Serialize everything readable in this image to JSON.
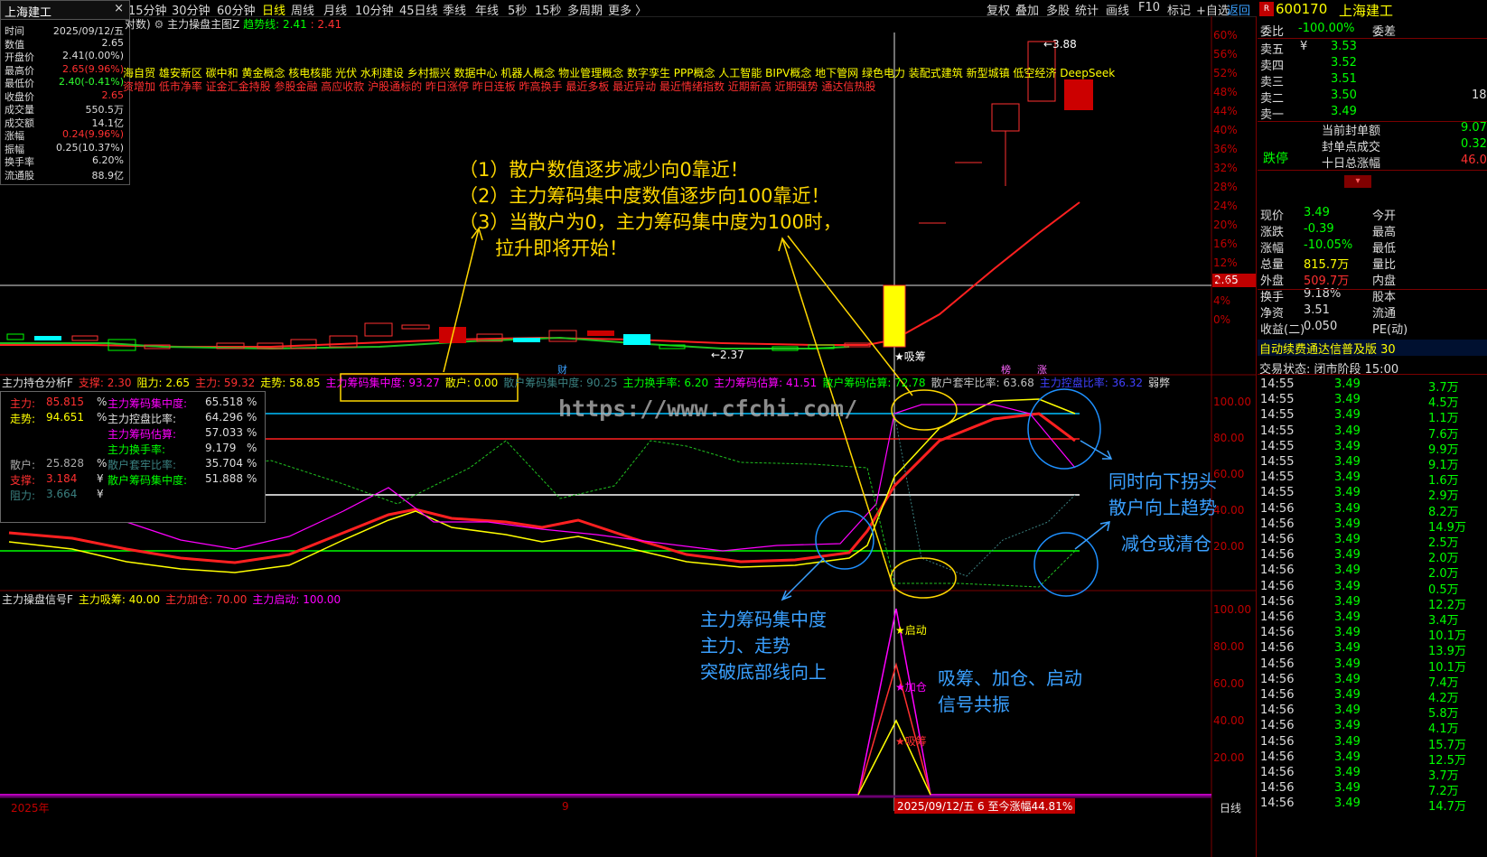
{
  "toolbar": {
    "tabs": [
      "15分钟",
      "30分钟",
      "60分钟",
      "日线",
      "周线",
      "月线",
      "10分钟",
      "45日线",
      "季线",
      "年线",
      "5秒",
      "15秒",
      "多周期",
      "更多 〉"
    ],
    "active_tab": "日线",
    "right_tools": [
      "复权",
      "叠加",
      "多股",
      "统计",
      "画线",
      "F10",
      "标记",
      "+自选",
      "返回"
    ]
  },
  "window": {
    "title": "上海建工",
    "close": "×"
  },
  "info_box": [
    {
      "k": "时间",
      "v": "2025/09/12/五",
      "c": "#ddd"
    },
    {
      "k": "数值",
      "v": "2.65",
      "c": "#ddd"
    },
    {
      "k": "开盘价",
      "v": "2.41(0.00%)",
      "c": "#ddd"
    },
    {
      "k": "最高价",
      "v": "2.65(9.96%)",
      "c": "#ff3030"
    },
    {
      "k": "最低价",
      "v": "2.40(-0.41%)",
      "c": "#30ff30"
    },
    {
      "k": "收盘价",
      "v": "2.65",
      "c": "#ff3030"
    },
    {
      "k": "成交量",
      "v": "550.5万",
      "c": "#ddd"
    },
    {
      "k": "成交额",
      "v": "14.1亿",
      "c": "#ddd"
    },
    {
      "k": "涨幅",
      "v": "0.24(9.96%)",
      "c": "#ff3030"
    },
    {
      "k": "振幅",
      "v": "0.25(10.37%)",
      "c": "#ddd"
    },
    {
      "k": "换手率",
      "v": "6.20%",
      "c": "#ddd"
    },
    {
      "k": "流通股",
      "v": "88.9亿",
      "c": "#ddd"
    }
  ],
  "main_chart": {
    "header_prefix": "对数)",
    "indicator_name": "主力操盘主图Z",
    "trend_label": "趋势线: 2.41",
    "trend_value": ": 2.41",
    "concepts_row1": "海自贸  雄安新区  碳中和  黄金概念  核电核能  光伏  水利建设  乡村振兴  数据中心  机器人概念  物业管理概念  数字孪生  PPP概念  人工智能  BIPV概念  地下管网  绿色电力  装配式建筑  新型城镇  低空经济  DeepSeek",
    "concepts_row2": "资增加  低市净率  证金汇金持股  参股金融  高应收款  沪股通标的  昨日涨停  昨日连板  昨高换手  最近多板  最近异动  最近情绪指数  近期新高  近期强势  通达信热股",
    "price_label": "2.65",
    "high_marker": "←3.88",
    "low_marker": "←2.37",
    "xishou_label": "★吸筹",
    "cai_label": "财",
    "bang_label": "榜",
    "zhang_label": "涨",
    "yaxis": [
      "60%",
      "56%",
      "52%",
      "48%",
      "44%",
      "40%",
      "36%",
      "32%",
      "28%",
      "24%",
      "20%",
      "16%",
      "12%",
      "8%",
      "4%",
      "0%"
    ]
  },
  "annotations": {
    "main_text": [
      "（1）散户数值逐步减少向0靠近！",
      "（2）主力筹码集中度数值逐步向100靠近！",
      "（3）当散户为0，主力筹码集中度为100时，",
      "      拉升即将开始！"
    ],
    "break_text": [
      "主力筹码集中度",
      "主力、走势",
      "突破底部线向上"
    ],
    "turn_text": [
      "同时向下拐头",
      "散户向上趋势"
    ],
    "reduce_text": "减仓或清仓",
    "signal_text": [
      "吸筹、加仓、启动",
      "信号共振"
    ],
    "watermark": "https://www.cfchi.com/"
  },
  "sub1": {
    "header": [
      {
        "t": "主力持仓分析F",
        "c": "#e0e0e0"
      },
      {
        "t": "支撑: 2.30",
        "c": "#ff3030"
      },
      {
        "t": "阻力: 2.65",
        "c": "#ffff00"
      },
      {
        "t": "主力: 59.32",
        "c": "#ff3030"
      },
      {
        "t": "走势: 58.85",
        "c": "#ffff00"
      },
      {
        "t": "主力筹码集中度: 93.27",
        "c": "#ff00ff"
      },
      {
        "t": "散户: 0.00",
        "c": "#ffff00"
      },
      {
        "t": "散户筹码集中度: 90.25",
        "c": "#3a8080"
      },
      {
        "t": "主力换手率: 6.20",
        "c": "#00ff00"
      },
      {
        "t": "主力筹码估算: 41.51",
        "c": "#ff00ff"
      },
      {
        "t": "散户筹码估算: 72.78",
        "c": "#00ff00"
      },
      {
        "t": "散户套牢比率: 63.68",
        "c": "#c0c0c0"
      },
      {
        "t": "主力控盘比率: 36.32",
        "c": "#4040ff"
      },
      {
        "t": "弱弊",
        "c": "#e0e0e0"
      }
    ],
    "legend": [
      {
        "k": "主力:",
        "v": "85.815",
        "u": "%",
        "c": "#ff3030",
        "k2": "主力筹码集中度:",
        "v2": "65.518",
        "u2": "%",
        "c2": "#ff00ff"
      },
      {
        "k": "走势:",
        "v": "94.651",
        "u": "%",
        "c": "#ffff00",
        "k2": "主力控盘比率:",
        "v2": "64.296",
        "u2": "%",
        "c2": "#e0e0e0"
      },
      {
        "k": "",
        "v": "",
        "u": "",
        "c": "#ddd",
        "k2": "主力筹码估算:",
        "v2": "57.033",
        "u2": "%",
        "c2": "#ff00ff"
      },
      {
        "k": "",
        "v": "",
        "u": "",
        "c": "#ddd",
        "k2": "主力换手率:",
        "v2": "9.179",
        "u2": "%",
        "c2": "#00ff00"
      },
      {
        "k": "散户:",
        "v": "25.828",
        "u": "%",
        "c": "#aaaaaa",
        "k2": "散户套牢比率:",
        "v2": "35.704",
        "u2": "%",
        "c2": "#3a8080"
      },
      {
        "k": "支撑:",
        "v": "3.184",
        "u": "¥",
        "c": "#ff3030",
        "k2": "散户筹码集中度:",
        "v2": "51.888",
        "u2": "%",
        "c2": "#00ff00"
      },
      {
        "k": "阻力:",
        "v": "3.664",
        "u": "¥",
        "c": "#3a8080",
        "k2": "",
        "v2": "",
        "u2": "",
        "c2": "#ddd"
      }
    ],
    "yaxis": [
      "100.00",
      "80.00",
      "60.00",
      "40.00",
      "20.00"
    ]
  },
  "sub2": {
    "header": [
      {
        "t": "主力操盘信号F",
        "c": "#e0e0e0"
      },
      {
        "t": "主力吸筹: 40.00",
        "c": "#ffff00"
      },
      {
        "t": "主力加仓: 70.00",
        "c": "#ff3030"
      },
      {
        "t": "主力启动: 100.00",
        "c": "#ff00ff"
      }
    ],
    "start_label": "★启动",
    "add_label": "★加仓",
    "absorb_label": "★吸筹",
    "yaxis": [
      "100.00",
      "80.00",
      "60.00",
      "40.00",
      "20.00"
    ],
    "x_left": "2025年",
    "x_mid": "9",
    "date_box": "2025/09/12/五 6 至今涨幅44.81%",
    "period": "日线"
  },
  "quote": {
    "code": "600170",
    "name": "上海建工",
    "weibi_k": "委比",
    "weibi_v": "-100.00%",
    "weicha_k": "委差",
    "asks": [
      {
        "k": "卖五",
        "v": "3.53"
      },
      {
        "k": "卖四",
        "v": "3.52"
      },
      {
        "k": "卖三",
        "v": "3.51"
      },
      {
        "k": "卖二",
        "v": "3.50"
      },
      {
        "k": "卖一",
        "v": "3.49"
      }
    ],
    "ask_extra": {
      "five": "¥",
      "two": "18"
    },
    "dieting": "跌停",
    "seal_rows": [
      {
        "k": "当前封单额",
        "v": "9.07"
      },
      {
        "k": "封单点成交",
        "v": "0.32"
      },
      {
        "k": "十日总涨幅",
        "v": "46.0"
      }
    ],
    "stats": [
      {
        "k": "现价",
        "v": "3.49",
        "k2": "今开",
        "vc": "#00ff00"
      },
      {
        "k": "涨跌",
        "v": "-0.39",
        "k2": "最高",
        "vc": "#00ff00"
      },
      {
        "k": "涨幅",
        "v": "-10.05%",
        "k2": "最低",
        "vc": "#00ff00"
      },
      {
        "k": "总量",
        "v": "815.7万",
        "k2": "量比",
        "vc": "#ffff00"
      },
      {
        "k": "外盘",
        "v": "509.7万",
        "k2": "内盘",
        "vc": "#ff3030"
      },
      {
        "k": "换手",
        "v": "9.18%",
        "k2": "股本",
        "vc": "#ddd"
      },
      {
        "k": "净资",
        "v": "3.51",
        "k2": "流通",
        "vc": "#ddd"
      },
      {
        "k": "收益(二)",
        "v": "0.050",
        "k2": "PE(动)",
        "vc": "#ddd"
      }
    ],
    "banner": "自动续费通达信普及版  30",
    "status": "交易状态: 闭市阶段 15:00"
  },
  "ticks": [
    {
      "t": "14:55",
      "p": "3.49",
      "v": "3.7万"
    },
    {
      "t": "14:55",
      "p": "3.49",
      "v": "4.5万"
    },
    {
      "t": "14:55",
      "p": "3.49",
      "v": "1.1万"
    },
    {
      "t": "14:55",
      "p": "3.49",
      "v": "7.6万"
    },
    {
      "t": "14:55",
      "p": "3.49",
      "v": "9.9万"
    },
    {
      "t": "14:55",
      "p": "3.49",
      "v": "9.1万"
    },
    {
      "t": "14:55",
      "p": "3.49",
      "v": "1.6万"
    },
    {
      "t": "14:55",
      "p": "3.49",
      "v": "2.9万"
    },
    {
      "t": "14:56",
      "p": "3.49",
      "v": "8.2万"
    },
    {
      "t": "14:56",
      "p": "3.49",
      "v": "14.9万"
    },
    {
      "t": "14:56",
      "p": "3.49",
      "v": "2.5万"
    },
    {
      "t": "14:56",
      "p": "3.49",
      "v": "2.0万"
    },
    {
      "t": "14:56",
      "p": "3.49",
      "v": "2.0万"
    },
    {
      "t": "14:56",
      "p": "3.49",
      "v": "0.5万"
    },
    {
      "t": "14:56",
      "p": "3.49",
      "v": "12.2万"
    },
    {
      "t": "14:56",
      "p": "3.49",
      "v": "3.4万"
    },
    {
      "t": "14:56",
      "p": "3.49",
      "v": "10.1万"
    },
    {
      "t": "14:56",
      "p": "3.49",
      "v": "13.9万"
    },
    {
      "t": "14:56",
      "p": "3.49",
      "v": "10.1万"
    },
    {
      "t": "14:56",
      "p": "3.49",
      "v": "7.4万"
    },
    {
      "t": "14:56",
      "p": "3.49",
      "v": "4.2万"
    },
    {
      "t": "14:56",
      "p": "3.49",
      "v": "5.8万"
    },
    {
      "t": "14:56",
      "p": "3.49",
      "v": "4.1万"
    },
    {
      "t": "14:56",
      "p": "3.49",
      "v": "15.7万"
    },
    {
      "t": "14:56",
      "p": "3.49",
      "v": "12.5万"
    },
    {
      "t": "14:56",
      "p": "3.49",
      "v": "3.7万"
    },
    {
      "t": "14:56",
      "p": "3.49",
      "v": "7.2万"
    },
    {
      "t": "14:56",
      "p": "3.49",
      "v": "14.7万"
    }
  ],
  "colors": {
    "up": "#ff3030",
    "down": "#00ff00",
    "accent": "#ffff00",
    "border": "#7a0000",
    "annotation_yellow": "#ffff00",
    "annotation_blue": "#3aa0ff"
  }
}
